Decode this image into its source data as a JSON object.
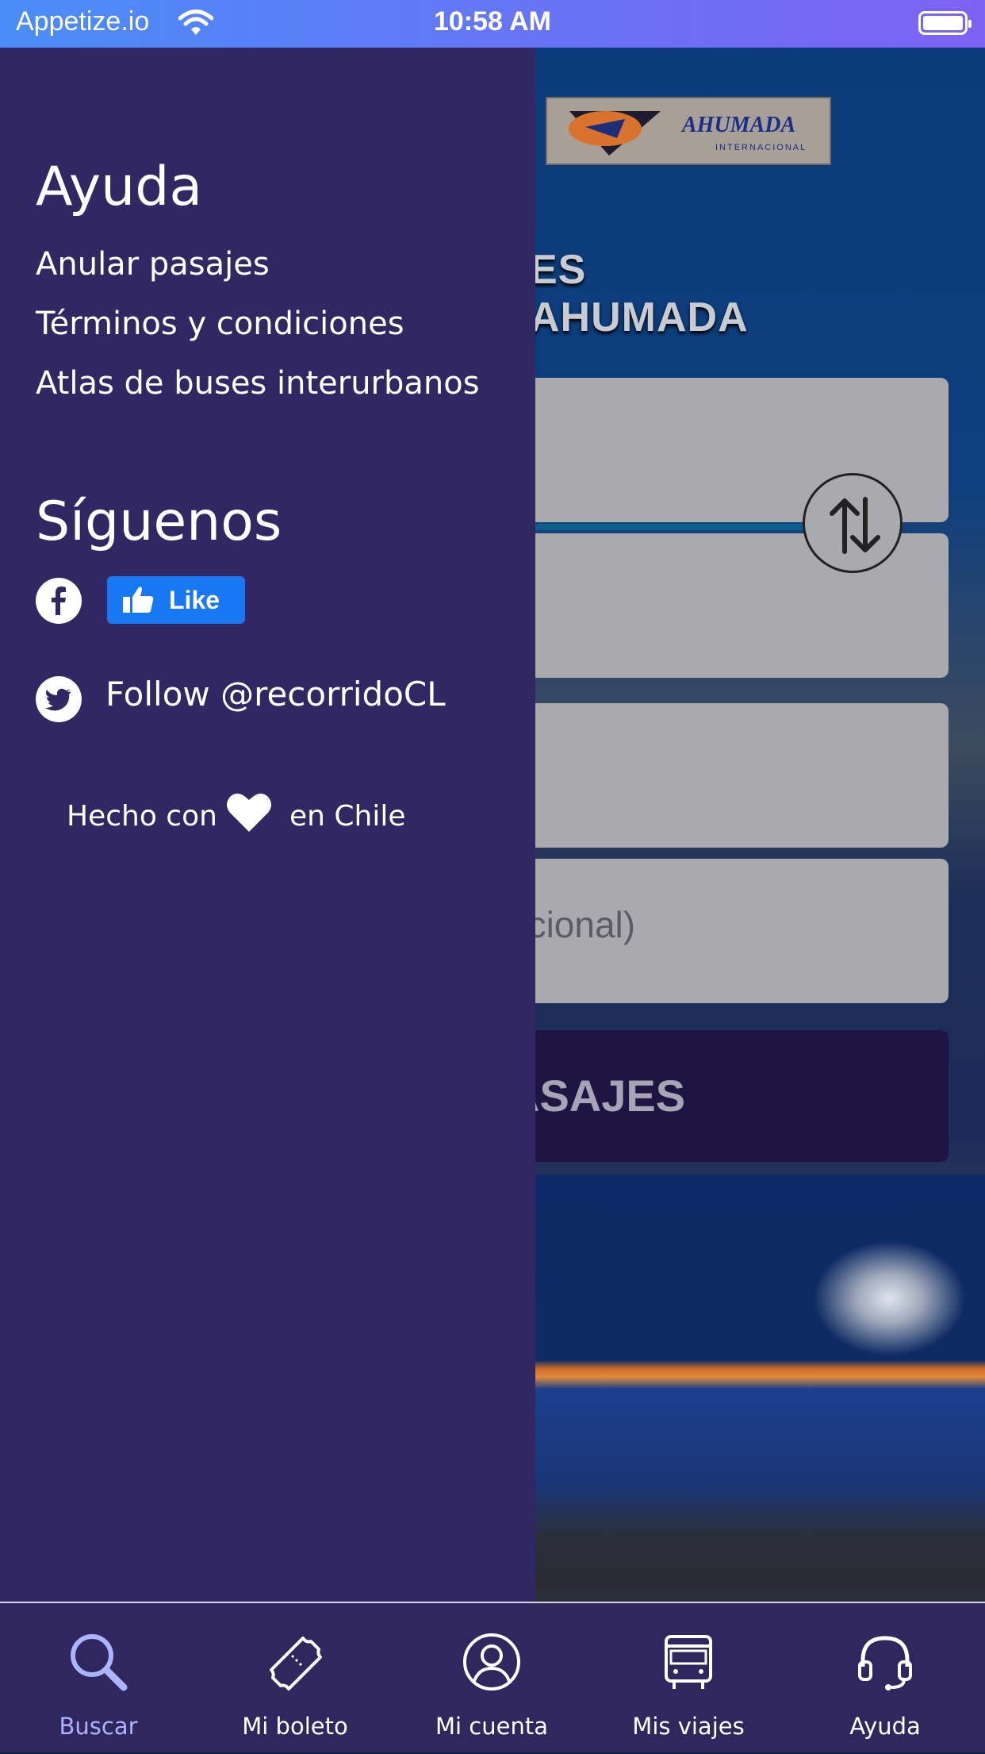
{
  "status_bar": {
    "carrier": "Appetize.io",
    "time": "10:58 AM"
  },
  "background": {
    "logo_text": "AHUMADA",
    "logo_subtext": "INTERNACIONAL",
    "title_partial": "ES AHUMADA",
    "field_optional_partial": "pcional)",
    "search_button_partial": "ASAJES"
  },
  "drawer": {
    "help_heading": "Ayuda",
    "help_links": [
      "Anular pasajes",
      "Términos y condiciones",
      "Atlas de buses interurbanos"
    ],
    "follow_heading": "Síguenos",
    "like_label": "Like",
    "twitter_follow": "Follow @recorridoCL",
    "made_with_prefix": "Hecho con",
    "made_with_suffix": "en Chile"
  },
  "tabs": [
    {
      "label": "Buscar",
      "icon": "search-icon",
      "active": true
    },
    {
      "label": "Mi boleto",
      "icon": "ticket-icon",
      "active": false
    },
    {
      "label": "Mi cuenta",
      "icon": "user-icon",
      "active": false
    },
    {
      "label": "Mis viajes",
      "icon": "bus-icon",
      "active": false
    },
    {
      "label": "Ayuda",
      "icon": "headset-icon",
      "active": false
    }
  ],
  "colors": {
    "drawer_bg": "#312763",
    "tabbar_bg": "#30275f",
    "active_tab": "#aab4ff",
    "facebook_like": "#1877f2"
  }
}
